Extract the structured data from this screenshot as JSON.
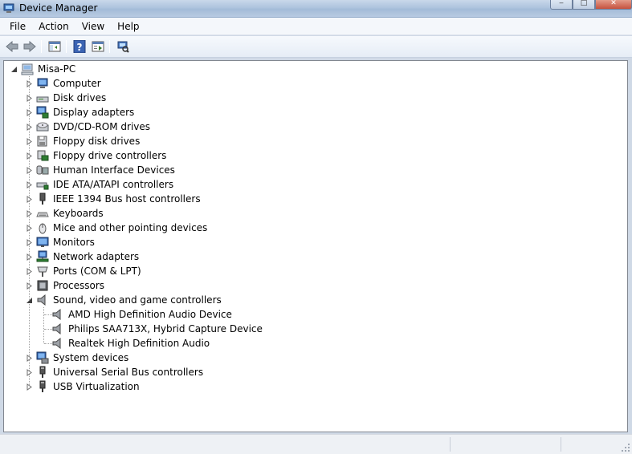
{
  "window": {
    "title": "Device Manager",
    "controls": [
      "minimize-icon",
      "maximize-icon",
      "close-icon"
    ]
  },
  "menu": [
    "File",
    "Action",
    "View",
    "Help"
  ],
  "toolbar": {
    "buttons": [
      "back-arrow-icon",
      "forward-arrow-icon",
      "show-hide-console-tree-icon",
      "help-icon",
      "properties-icon",
      "scan-hardware-icon"
    ]
  },
  "tree": {
    "root": "Misa-PC",
    "categories": [
      {
        "label": "Computer",
        "icon": "computer-icon",
        "expanded": false
      },
      {
        "label": "Disk drives",
        "icon": "disk-drive-icon",
        "expanded": false
      },
      {
        "label": "Display adapters",
        "icon": "display-adapter-icon",
        "expanded": false
      },
      {
        "label": "DVD/CD-ROM drives",
        "icon": "dvd-drive-icon",
        "expanded": false
      },
      {
        "label": "Floppy disk drives",
        "icon": "floppy-disk-icon",
        "expanded": false
      },
      {
        "label": "Floppy drive controllers",
        "icon": "floppy-controller-icon",
        "expanded": false
      },
      {
        "label": "Human Interface Devices",
        "icon": "hid-icon",
        "expanded": false
      },
      {
        "label": "IDE ATA/ATAPI controllers",
        "icon": "ide-controller-icon",
        "expanded": false
      },
      {
        "label": "IEEE 1394 Bus host controllers",
        "icon": "ieee1394-icon",
        "expanded": false
      },
      {
        "label": "Keyboards",
        "icon": "keyboard-icon",
        "expanded": false
      },
      {
        "label": "Mice and other pointing devices",
        "icon": "mouse-icon",
        "expanded": false
      },
      {
        "label": "Monitors",
        "icon": "monitor-icon",
        "expanded": false
      },
      {
        "label": "Network adapters",
        "icon": "network-adapter-icon",
        "expanded": false
      },
      {
        "label": "Ports (COM & LPT)",
        "icon": "port-icon",
        "expanded": false
      },
      {
        "label": "Processors",
        "icon": "processor-icon",
        "expanded": false
      },
      {
        "label": "Sound, video and game controllers",
        "icon": "speaker-icon",
        "expanded": true,
        "children": [
          "AMD High Definition Audio Device",
          "Philips SAA713X, Hybrid Capture Device",
          "Realtek High Definition Audio"
        ]
      },
      {
        "label": "System devices",
        "icon": "system-device-icon",
        "expanded": false
      },
      {
        "label": "Universal Serial Bus controllers",
        "icon": "usb-icon",
        "expanded": false
      },
      {
        "label": "USB Virtualization",
        "icon": "usb-icon",
        "expanded": false
      }
    ]
  },
  "colors": {
    "titlebar": "#aec4de",
    "menubar": "#f4f7fb",
    "tree_background": "#ffffff",
    "statusbar": "#eef1f5"
  }
}
